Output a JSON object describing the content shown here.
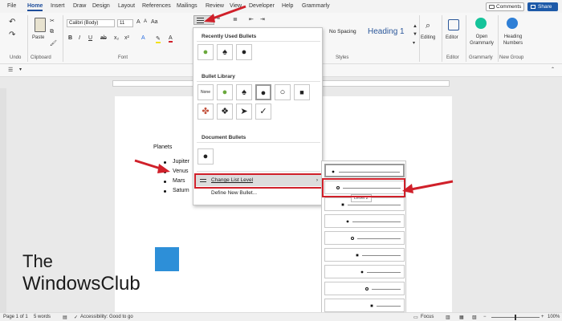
{
  "menubar": {
    "tabs": [
      "File",
      "Home",
      "Insert",
      "Draw",
      "Design",
      "Layout",
      "References",
      "Mailings",
      "Review",
      "View",
      "Developer",
      "Help",
      "Grammarly"
    ],
    "active_tab": "Home",
    "comments_label": "Comments",
    "share_label": "Share"
  },
  "ribbon": {
    "undo_label": "Undo",
    "clipboard_label": "Clipboard",
    "paste_label": "Paste",
    "font_label": "Font",
    "font_name": "Calibri (Body)",
    "font_size": "11",
    "styles_label": "Styles",
    "style_no_spacing": "No Spacing",
    "style_heading1": "Heading 1",
    "editing_label": "Editing",
    "editor_label": "Editor",
    "editor_group_label": "Editor",
    "grammarly_open": "Open Grammarly",
    "grammarly_group_label": "Grammarly",
    "heading_numbers": "Heading Numbers",
    "new_group_label": "New Group"
  },
  "document": {
    "heading": "Planets",
    "items": [
      "Jupiter",
      "Venus",
      "Mars",
      "Saturn"
    ]
  },
  "bullet_menu": {
    "recent_title": "Recently Used Bullets",
    "recent": [
      "●",
      "♠",
      "●"
    ],
    "library_title": "Bullet Library",
    "library": [
      "None",
      "●",
      "♠",
      "●",
      "○",
      "■",
      "✤",
      "❖",
      "➤",
      "✓"
    ],
    "document_title": "Document Bullets",
    "document_bullets": [
      "●"
    ],
    "change_level": "Change List Level",
    "define_new": "Define New Bullet..."
  },
  "level_submenu": {
    "tooltip": "Level 2",
    "levels": [
      "●",
      "○",
      "■",
      "●",
      "○",
      "■",
      "●",
      "○",
      "■"
    ]
  },
  "statusbar": {
    "page": "Page 1 of 1",
    "words": "5 words",
    "accessibility": "Accessibility: Good to go",
    "focus": "Focus",
    "zoom": "100%"
  },
  "watermark": {
    "line1": "The",
    "line2": "WindowsClub"
  },
  "colors": {
    "accent": "#1f4e9b",
    "share": "#1e5aa8",
    "highlight_box": "#d0202a",
    "green_bullet": "#6aa83c",
    "grammarly": "#15c39a"
  }
}
